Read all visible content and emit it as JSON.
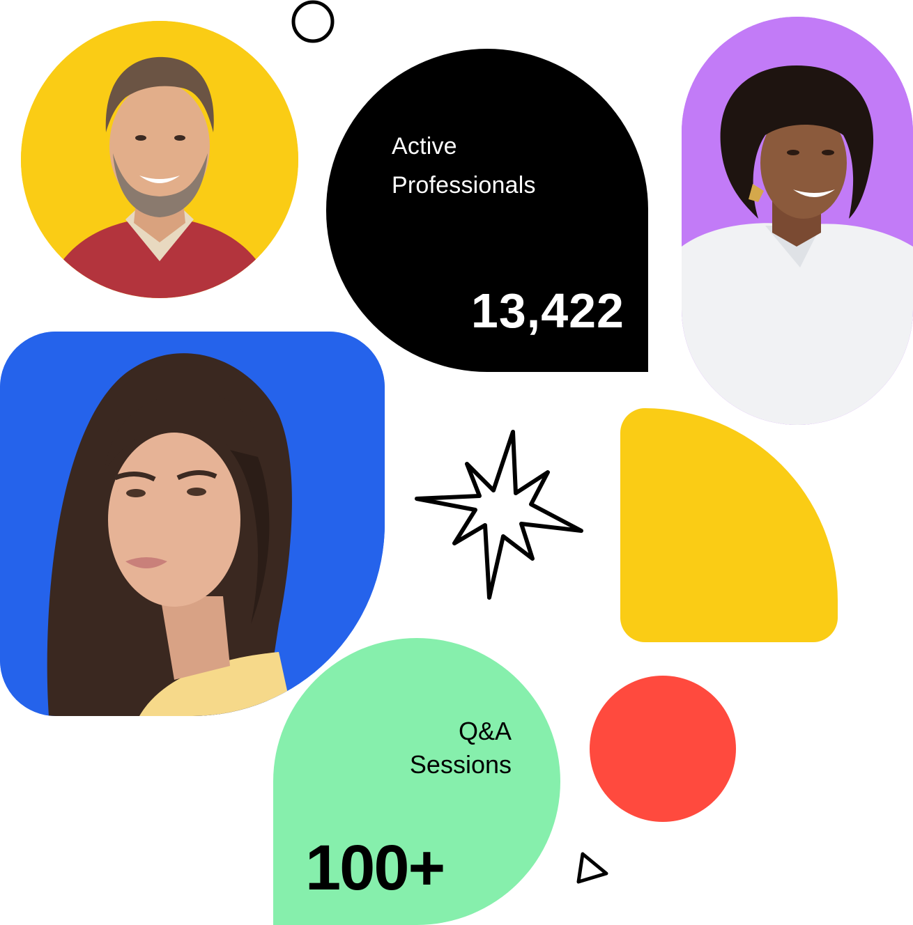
{
  "colors": {
    "yellow": "#FACC15",
    "purple": "#C27BF7",
    "blue": "#2563EB",
    "green": "#86EFAC",
    "red": "#FF4A3E",
    "black": "#000000"
  },
  "stats": [
    {
      "label_lines": [
        "Active",
        "Professionals"
      ],
      "value": "13,422"
    },
    {
      "label_lines": [
        "Q&A",
        "Sessions"
      ],
      "value": "100+"
    }
  ],
  "decorations": [
    "ring-icon",
    "sparkle-star-icon",
    "triangle-icon",
    "red-dot",
    "yellow-quarter-shape"
  ]
}
